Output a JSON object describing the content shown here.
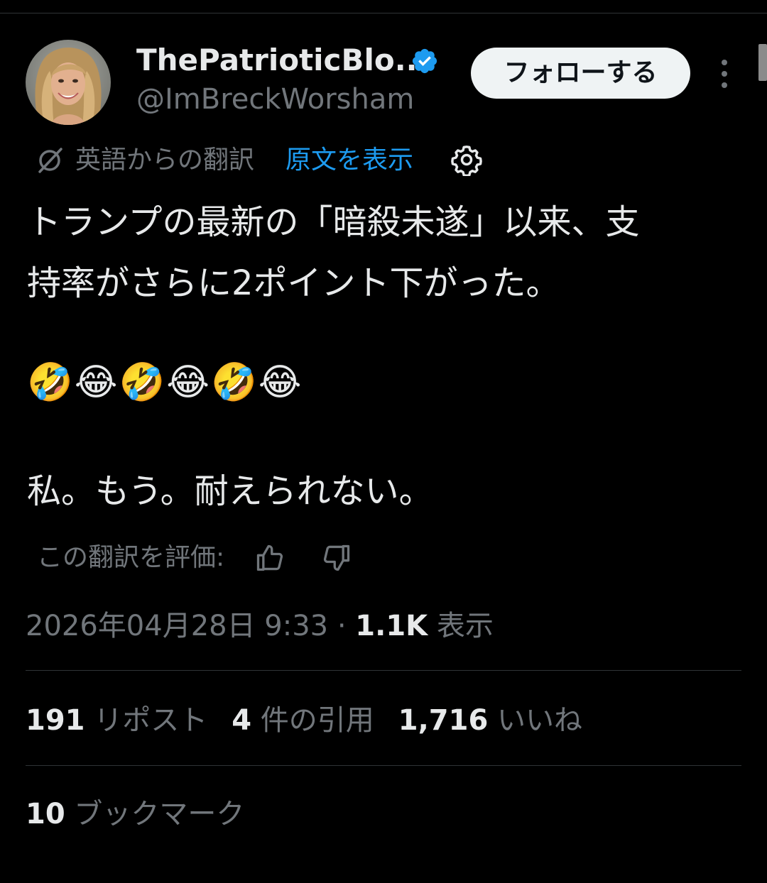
{
  "author": {
    "display_name": "ThePatrioticBlo...",
    "handle": "@ImBreckWorsham",
    "verified": true,
    "follow_label": "フォローする"
  },
  "translation": {
    "translated_from": "英語からの翻訳",
    "show_original": "原文を表示",
    "rate_label": "この翻訳を評価:"
  },
  "tweet": {
    "text_line1": "トランプの最新の「暗殺未遂」以来、支\n持率がさらに2ポイント下がった。",
    "emoji": "🤣😂🤣😂🤣😂",
    "text_line2": "私。もう。耐えられない。"
  },
  "meta": {
    "datetime": "2026年04月28日 9:33",
    "separator": "·",
    "views_count": "1.1K",
    "views_label": "表示"
  },
  "stats": {
    "reposts_count": "191",
    "reposts_label": "リポスト",
    "quotes_count": "4",
    "quotes_label": "件の引用",
    "likes_count": "1,716",
    "likes_label": "いいね",
    "bookmarks_count": "10",
    "bookmarks_label": "ブックマーク"
  },
  "colors": {
    "background": "#000000",
    "text_primary": "#e7e9ea",
    "text_secondary": "#71767b",
    "link_blue": "#1d9bf0",
    "divider": "#2f3336",
    "follow_bg": "#eff3f4"
  }
}
